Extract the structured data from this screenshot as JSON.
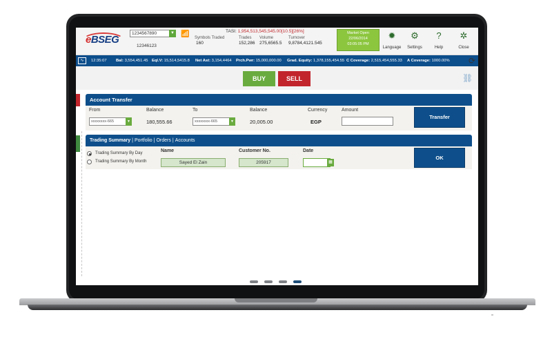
{
  "header": {
    "logo": "eBSEG",
    "account_selected": "1234567890",
    "account_sub": "12346123",
    "tasi_label": "TASI:",
    "tasi_value": "1,954,513,545,545.00[10.5][26%]",
    "symbols_traded_label": "Symbols Traded",
    "symbols_traded_value": "160",
    "trades_label": "Trades",
    "trades_value": "152,286",
    "volume_label": "Volume",
    "volume_value": "275,6565.5",
    "turnover_label": "Turnover",
    "turnover_value": "9,8784,4121.545",
    "market_status": "Market Open",
    "market_date": "22/06/2014",
    "market_time": "03:05:05 PM",
    "buttons": [
      {
        "label": "Language",
        "icon": "globe-icon"
      },
      {
        "label": "Settings",
        "icon": "gear-icon"
      },
      {
        "label": "Help",
        "icon": "help-icon"
      },
      {
        "label": "Close",
        "icon": "close-icon"
      }
    ]
  },
  "infobar": {
    "time": "12:35:07",
    "bal_label": "Bal:",
    "bal_value": "3,554,451.45",
    "eqlv_label": "Eql.V:",
    "eqlv_value": "15,514,5415.8",
    "netast_label": "Net Ast:",
    "netast_value": "3,154,4464",
    "prchpwr_label": "Prch.Pwr:",
    "prchpwr_value": "15,000,000.00",
    "gradequity_label": "Grad. Equity:",
    "gradequity_value": "1,378,155,454.55",
    "ccoverage_label": "C Coverage:",
    "ccoverage_value": "2,515,454,555.33",
    "acoverage_label": "A Coverage:",
    "acoverage_value": "1000.00%"
  },
  "trade": {
    "buy_label": "BUY",
    "sell_label": "SELL"
  },
  "account_transfer": {
    "title": "Account Transfer",
    "from_label": "From",
    "from_value": "xxxxxxxx-665",
    "balance_label": "Balance",
    "from_balance": "180,555.66",
    "to_label": "To",
    "to_value": "xxxxxxxx-665",
    "to_balance_label": "Balance",
    "to_balance": "20,005.00",
    "currency_label": "Currency",
    "currency_value": "EGP",
    "amount_label": "Amount",
    "amount_value": "",
    "transfer_button": "Transfer"
  },
  "tabs": [
    {
      "label": "Trading Summary"
    },
    {
      "label": "Portfolio"
    },
    {
      "label": "Orders"
    },
    {
      "label": "Accounts"
    }
  ],
  "trading_summary": {
    "radio_day": "Trading Summary By Day",
    "radio_month": "Trading Summary By Month",
    "name_label": "Name",
    "name_value": "Sayed El Zain",
    "customer_label": "Customer No.",
    "customer_value": "205917",
    "date_label": "Date",
    "date_value": "",
    "ok_button": "OK"
  },
  "pager": {
    "pages": 4,
    "active": 4
  }
}
